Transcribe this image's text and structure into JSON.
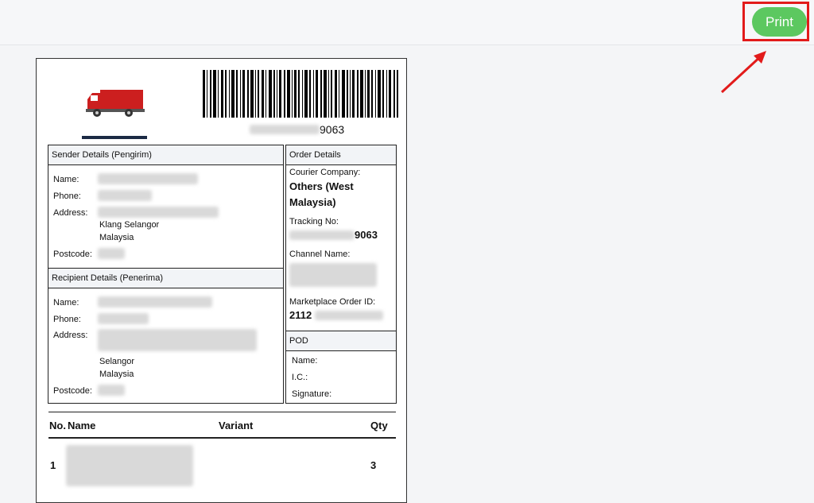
{
  "toolbar": {
    "print_label": "Print"
  },
  "label": {
    "barcode_suffix": "9063",
    "sender": {
      "heading": "Sender Details (Pengirim)",
      "name_label": "Name:",
      "phone_label": "Phone:",
      "address_label": "Address:",
      "address_line_city": "Klang Selangor",
      "address_line_country": "Malaysia",
      "postcode_label": "Postcode:"
    },
    "recipient": {
      "heading": "Recipient Details (Penerima)",
      "name_label": "Name:",
      "phone_label": "Phone:",
      "address_label": "Address:",
      "address_line_state": "Selangor",
      "address_line_country": "Malaysia",
      "postcode_label": "Postcode:"
    },
    "order": {
      "heading": "Order Details",
      "courier_label": "Courier Company:",
      "courier_value_line1": "Others (West",
      "courier_value_line2": "Malaysia)",
      "tracking_label": "Tracking No:",
      "tracking_suffix": "9063",
      "channel_label": "Channel Name:",
      "marketplace_label": "Marketplace Order ID:",
      "marketplace_prefix": "2112"
    },
    "pod": {
      "heading": "POD",
      "name_label": "Name:",
      "ic_label": "I.C.:",
      "signature_label": "Signature:"
    },
    "items": {
      "headers": {
        "no": "No.",
        "name": "Name",
        "variant": "Variant",
        "qty": "Qty"
      },
      "rows": [
        {
          "no": "1",
          "qty": "3"
        }
      ]
    }
  }
}
